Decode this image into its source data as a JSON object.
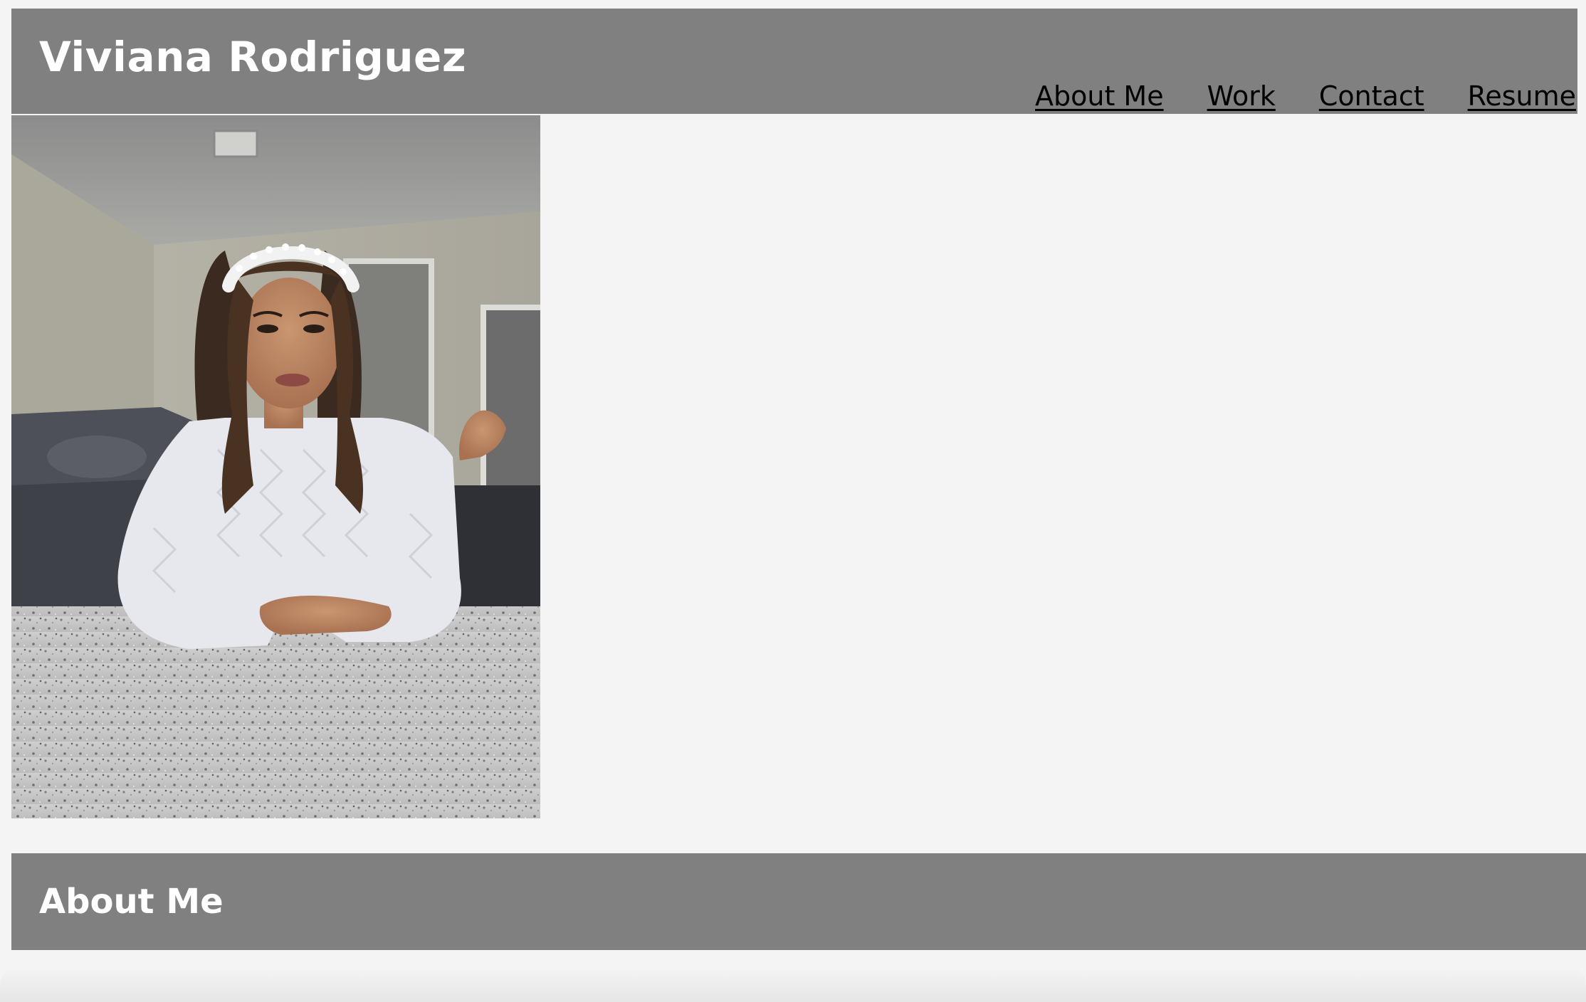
{
  "site": {
    "title": "Viviana Rodriguez"
  },
  "nav": {
    "items": [
      {
        "label": "About Me"
      },
      {
        "label": "Work"
      },
      {
        "label": "Contact"
      },
      {
        "label": "Resume"
      }
    ]
  },
  "section": {
    "title": "About Me"
  },
  "colors": {
    "header_bg": "#808080",
    "page_bg": "#f4f4f4",
    "title_text": "#ffffff",
    "nav_link": "#000000"
  }
}
